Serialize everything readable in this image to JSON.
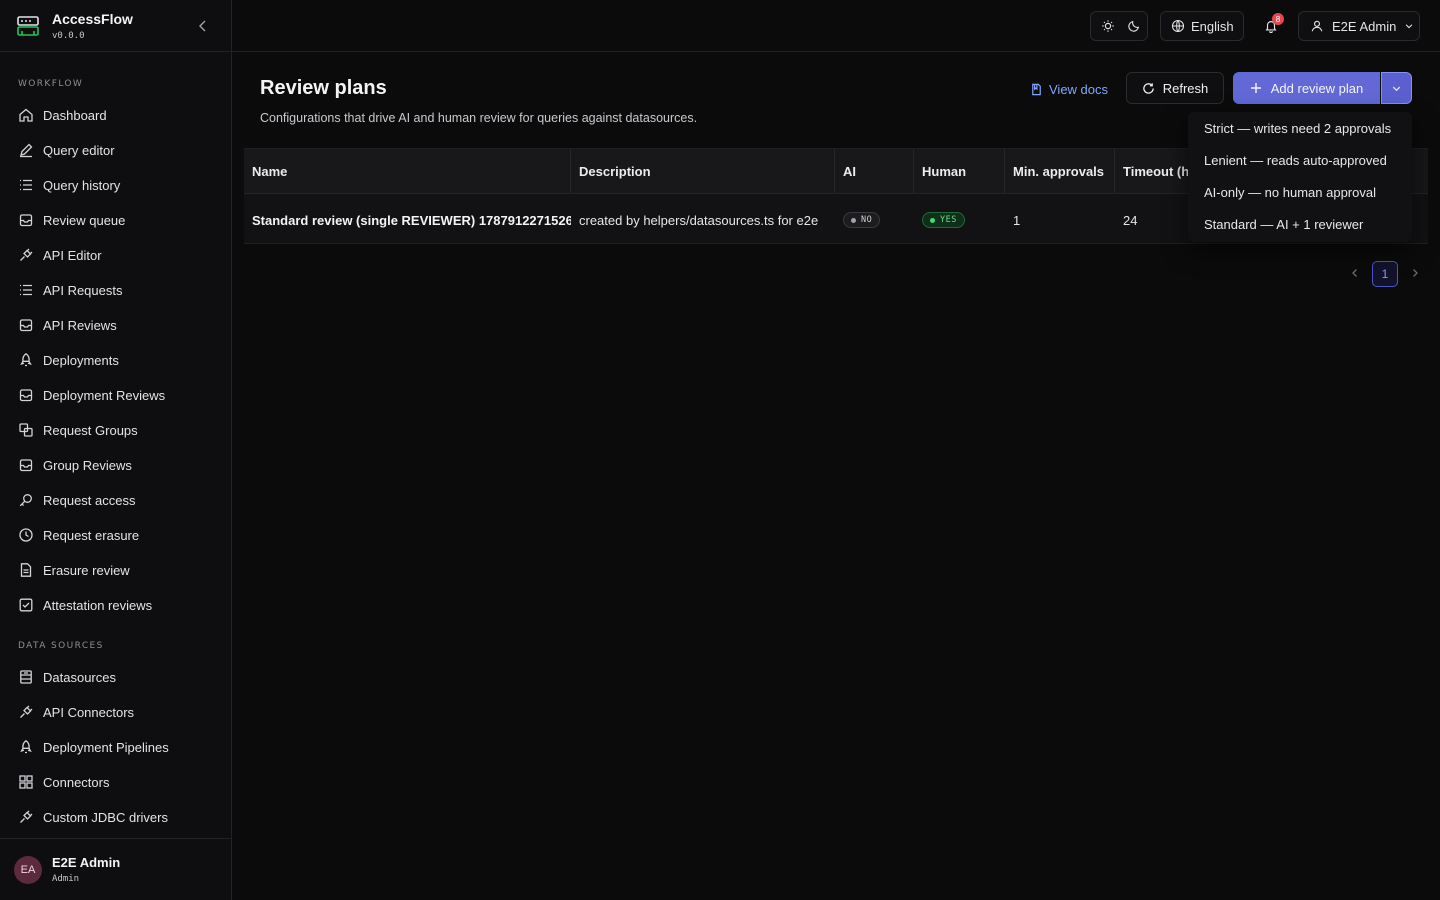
{
  "app": {
    "name": "AccessFlow",
    "version": "v0.0.0"
  },
  "sidebar": {
    "workflow_label": "WORKFLOW",
    "workflow": [
      {
        "label": "Dashboard",
        "icon": "home-icon"
      },
      {
        "label": "Query editor",
        "icon": "pencil-icon"
      },
      {
        "label": "Query history",
        "icon": "list-icon"
      },
      {
        "label": "Review queue",
        "icon": "inbox-icon"
      },
      {
        "label": "API Editor",
        "icon": "plug-icon"
      },
      {
        "label": "API Requests",
        "icon": "list-icon"
      },
      {
        "label": "API Reviews",
        "icon": "inbox-icon"
      },
      {
        "label": "Deployments",
        "icon": "rocket-icon"
      },
      {
        "label": "Deployment Reviews",
        "icon": "inbox-icon"
      },
      {
        "label": "Request Groups",
        "icon": "group-icon"
      },
      {
        "label": "Group Reviews",
        "icon": "inbox-icon"
      },
      {
        "label": "Request access",
        "icon": "key-icon"
      },
      {
        "label": "Request erasure",
        "icon": "clock-icon"
      },
      {
        "label": "Erasure review",
        "icon": "document-icon"
      },
      {
        "label": "Attestation reviews",
        "icon": "checkbox-icon"
      }
    ],
    "datasources_label": "DATA SOURCES",
    "datasources": [
      {
        "label": "Datasources",
        "icon": "database-icon"
      },
      {
        "label": "API Connectors",
        "icon": "plug-icon"
      },
      {
        "label": "Deployment Pipelines",
        "icon": "rocket-icon"
      },
      {
        "label": "Connectors",
        "icon": "grid-icon"
      },
      {
        "label": "Custom JDBC drivers",
        "icon": "plug-icon"
      }
    ],
    "footer": {
      "initials": "EA",
      "name": "E2E Admin",
      "role": "Admin"
    }
  },
  "topbar": {
    "language": "English",
    "notification_count": "8",
    "user": "E2E Admin"
  },
  "page": {
    "title": "Review plans",
    "subtitle": "Configurations that drive AI and human review for queries against datasources.",
    "view_docs": "View docs",
    "refresh": "Refresh",
    "add": "Add review plan"
  },
  "table": {
    "columns": [
      "Name",
      "Description",
      "AI",
      "Human",
      "Min. approvals",
      "Timeout (h"
    ],
    "rows": [
      {
        "name": "Standard review (single REVIEWER) 1787912271526",
        "description": "created by helpers/datasources.ts for e2e",
        "ai": "NO",
        "human": "YES",
        "min_approvals": "1",
        "timeout": "24"
      }
    ]
  },
  "pagination": {
    "current": "1"
  },
  "dropdown": {
    "items": [
      "Strict — writes need 2 approvals",
      "Lenient — reads auto-approved",
      "AI-only — no human approval",
      "Standard — AI + 1 reviewer"
    ]
  },
  "colors": {
    "accent": "#6268d6",
    "link": "#7fa7ff",
    "success": "#3ddc75",
    "danger": "#e5484d",
    "brand_logo": "#22c55e"
  }
}
